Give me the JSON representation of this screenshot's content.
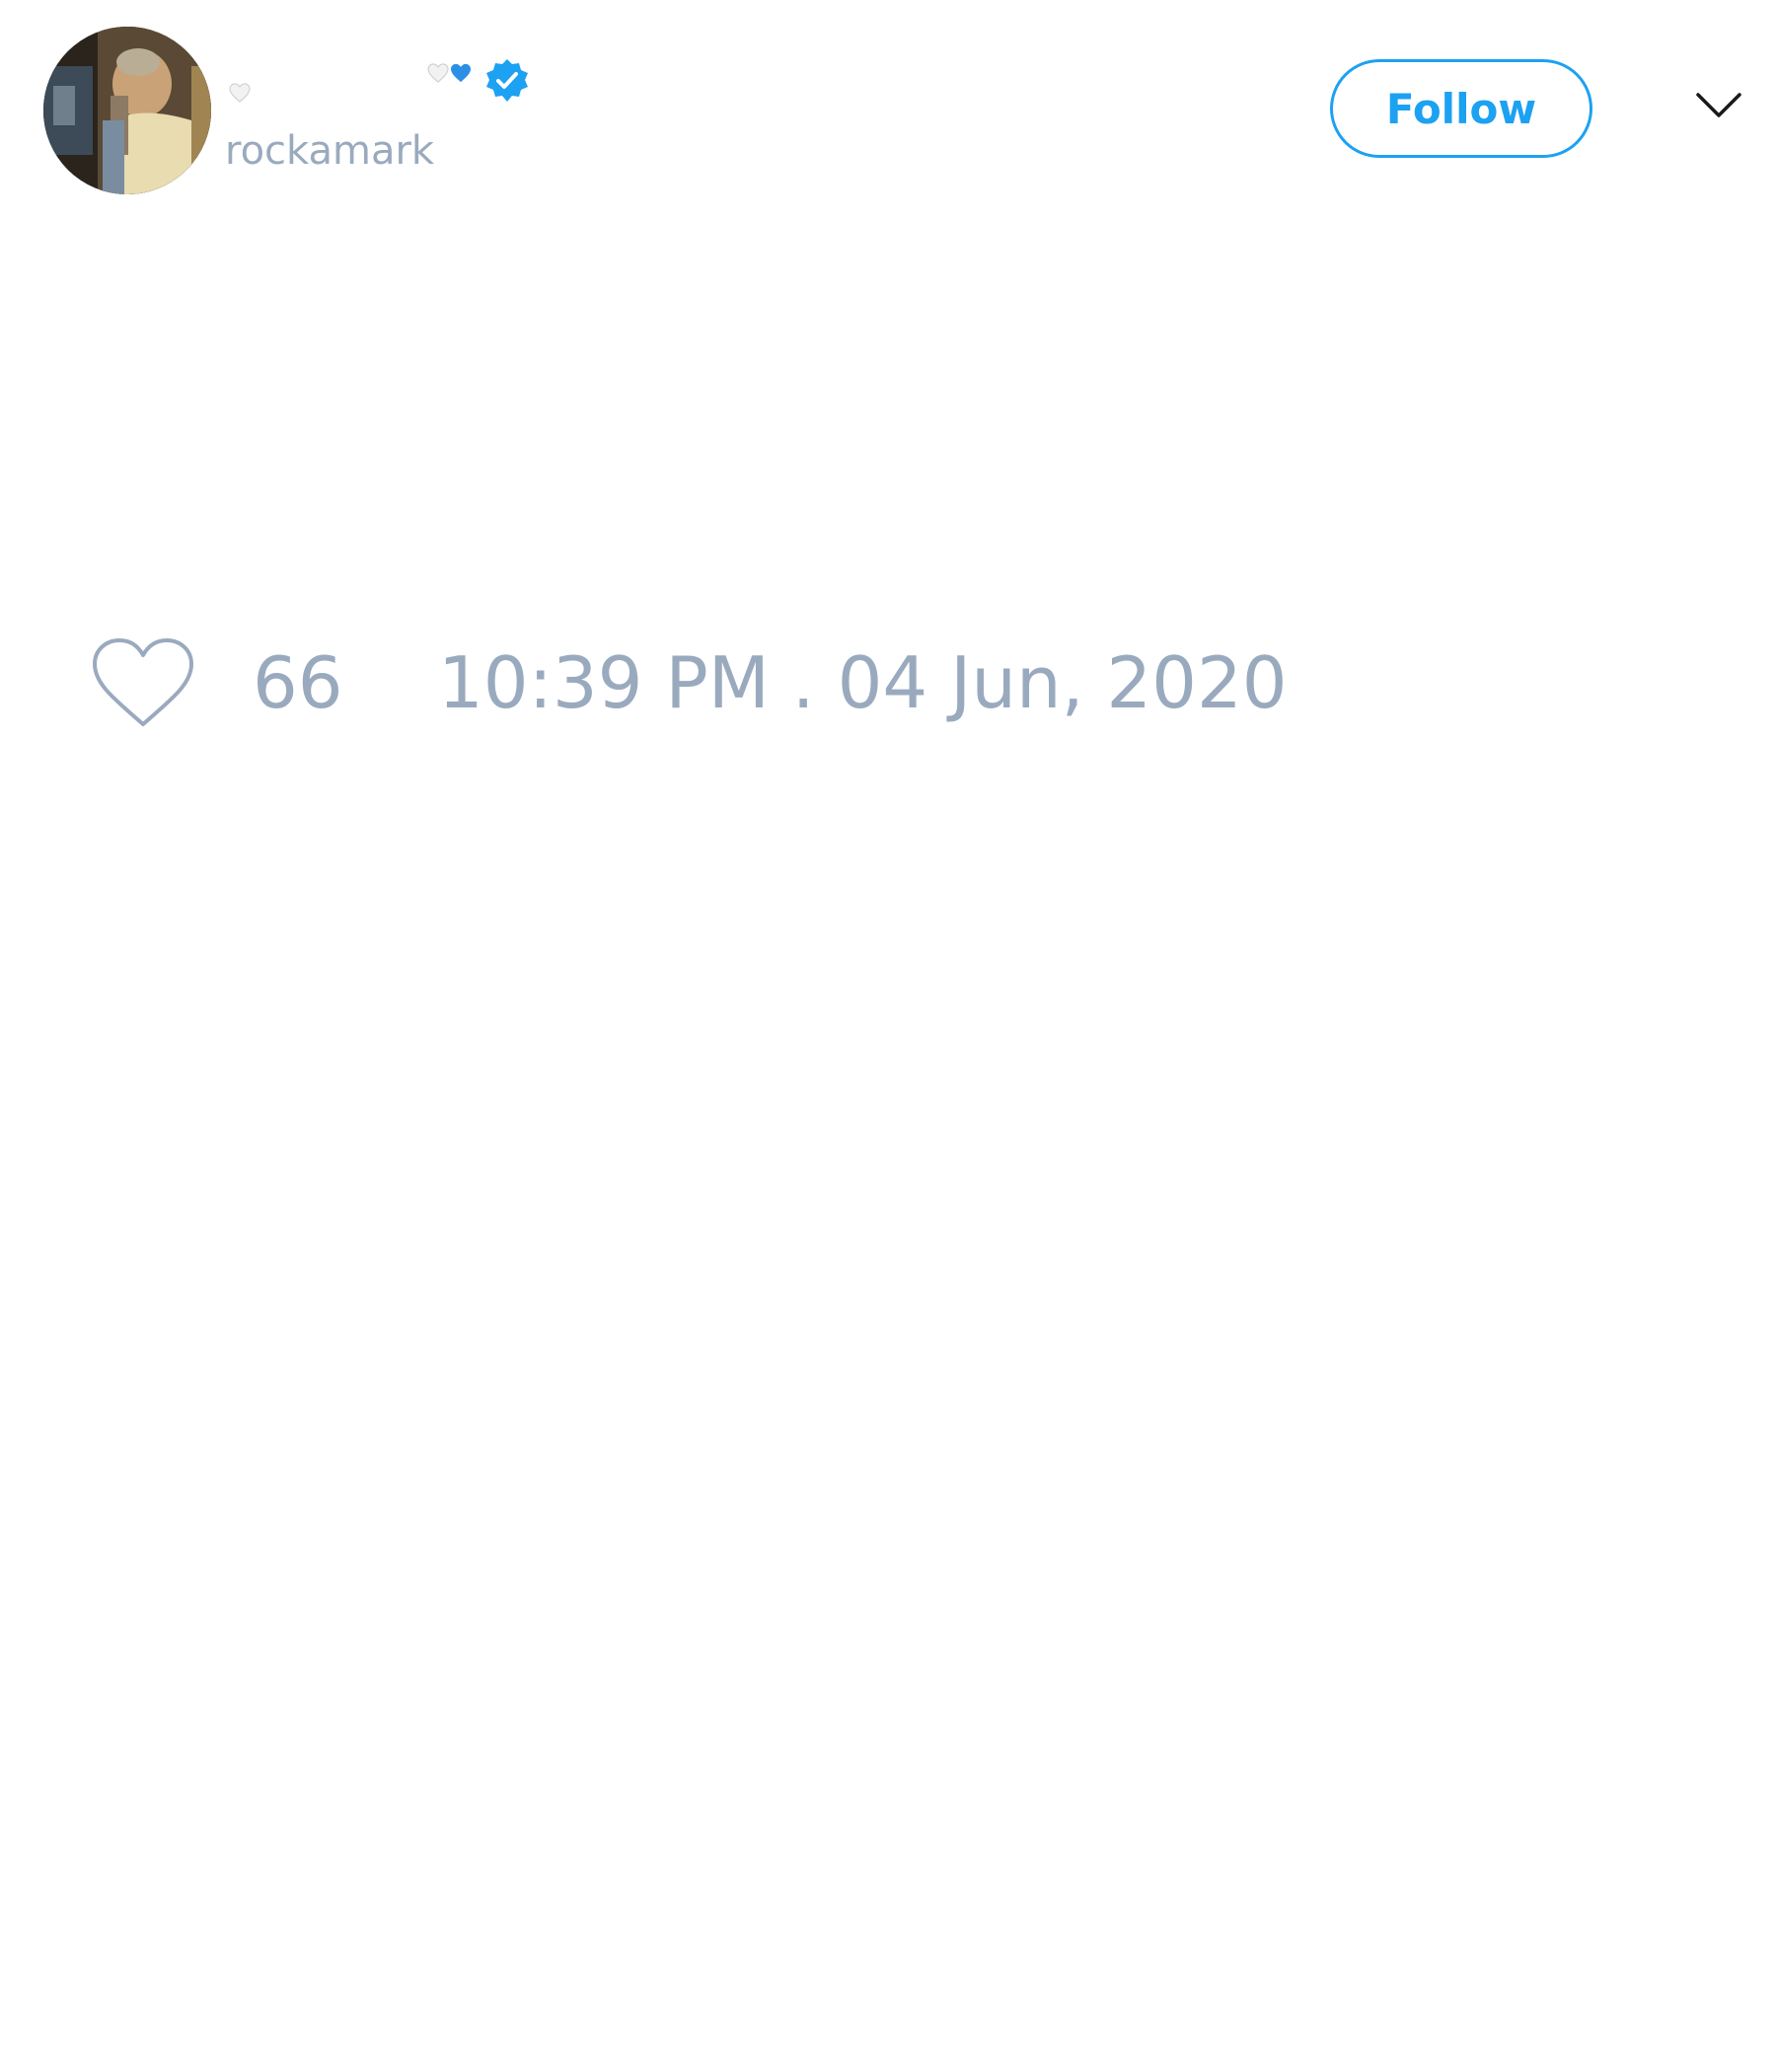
{
  "user": {
    "display_name_emoji": [
      "white-heart",
      "white-heart",
      "blue-heart"
    ],
    "handle": "rockamark",
    "verified": true
  },
  "header": {
    "follow_label": "Follow",
    "menu_icon": "chevron-down-icon"
  },
  "stats": {
    "like_icon": "heart-outline-icon",
    "like_count": "66",
    "timestamp": "10:39 PM . 04 Jun, 2020"
  },
  "colors": {
    "accent": "#1da1f2",
    "muted_text": "#9aaabe",
    "background": "#ffffff"
  }
}
